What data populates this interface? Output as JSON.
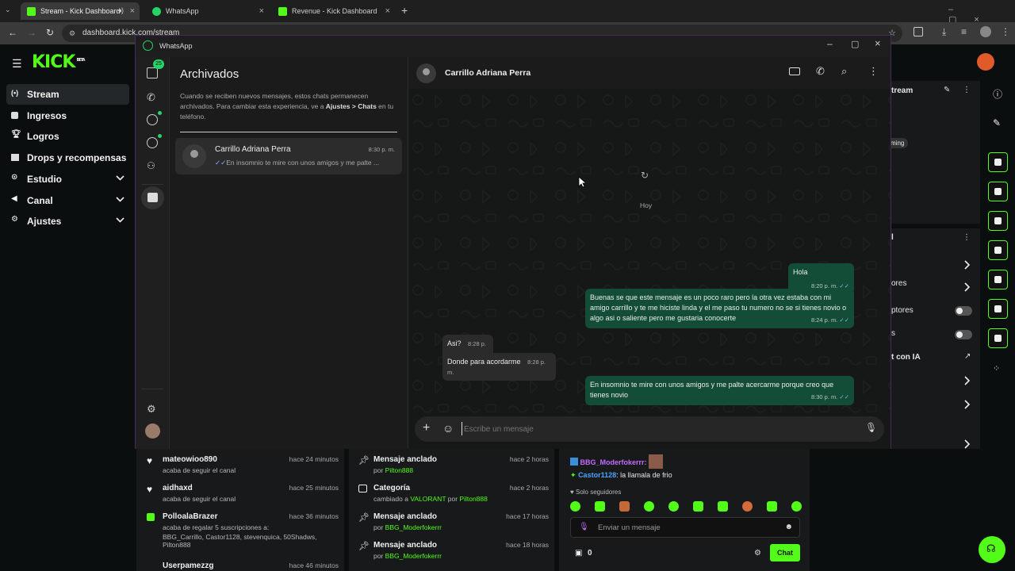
{
  "browser": {
    "tabs": [
      {
        "label": "Stream - Kick Dashboard",
        "active": true,
        "audio": true
      },
      {
        "label": "WhatsApp",
        "active": false
      },
      {
        "label": "Revenue - Kick Dashboard",
        "active": false
      }
    ],
    "url": "dashboard.kick.com/stream"
  },
  "kick": {
    "logo": "KICK",
    "logo_badge": "BETA",
    "sidebar": [
      {
        "label": "Stream",
        "icon": "broadcast-icon",
        "active": true
      },
      {
        "label": "Ingresos",
        "icon": "dollar-icon"
      },
      {
        "label": "Logros",
        "icon": "trophy-icon"
      },
      {
        "label": "Drops y recompensas",
        "icon": "gift-icon"
      },
      {
        "label": "Estudio",
        "icon": "studio-icon",
        "expandable": true
      },
      {
        "label": "Canal",
        "icon": "megaphone-icon",
        "expandable": true
      },
      {
        "label": "Ajustes",
        "icon": "gear-icon",
        "expandable": true
      }
    ],
    "right_panel": {
      "stream_title": "tream",
      "badge": "ming",
      "rows": [
        "ores",
        "ptores",
        "s",
        "t con IA"
      ]
    },
    "activity_feed": [
      {
        "title": "mateowioo890",
        "sub": "acaba de seguir el canal",
        "time": "hace 24 minutos",
        "icon": "heart-icon"
      },
      {
        "title": "aidhaxd",
        "sub": "acaba de seguir el canal",
        "time": "hace 25 minutos",
        "icon": "heart-icon"
      },
      {
        "title": "PolloalaBrazer",
        "sub": "acaba de regalar 5 suscripciones a:",
        "names": "BBG_Carrillo, Castor1128, stevenquica, 50Shadws, Pilton888",
        "time": "hace 36 minutos",
        "icon": "gift-icon"
      },
      {
        "title": "Userpamezzg",
        "time": "hace 46 minutos",
        "icon": "heart-icon"
      }
    ],
    "mod_log": [
      {
        "title": "Mensaje anclado",
        "by_prefix": "por",
        "by": "Pilton888",
        "time": "hace 2 horas",
        "icon": "pin-icon"
      },
      {
        "title": "Categoría",
        "by_prefix": "cambiado a",
        "by": "VALORANT",
        "by2_prefix": "por",
        "by2": "Pilton888",
        "time": "hace 2 horas",
        "icon": "category-icon"
      },
      {
        "title": "Mensaje anclado",
        "by_prefix": "por",
        "by": "BBG_Moderfokerrr",
        "time": "hace 17 horas",
        "icon": "pin-icon"
      },
      {
        "title": "Mensaje anclado",
        "by_prefix": "por",
        "by": "BBG_Moderfokerrr",
        "time": "hace 18 horas",
        "icon": "pin-icon"
      }
    ],
    "chat": {
      "msg1_user": "BBG_Moderfokerrr:",
      "msg2_user": "Castor1128",
      "msg2_text": ": la llamala de frio",
      "mode": "Solo seguidores",
      "input_placeholder": "Enviar un mensaje",
      "count": "0",
      "send_label": "Chat"
    }
  },
  "whatsapp": {
    "app_title": "WhatsApp",
    "unread_badge": "25",
    "list": {
      "title": "Archivados",
      "info_text": "Cuando se reciben nuevos mensajes, estos chats permanecen archivados. Para cambiar esta experiencia, ve a ",
      "info_bold": "Ajustes > Chats",
      "info_tail": " en tu teléfono.",
      "chats": [
        {
          "name": "Carrillo Adriana Perra",
          "time": "8:30 p. m.",
          "preview": "En insomnio te mire con unos amigos y me palte ..."
        }
      ]
    },
    "chat": {
      "contact": "Carrillo Adriana Perra",
      "day_divider": "Hoy",
      "messages": [
        {
          "dir": "out",
          "text": "Hola",
          "time": "8:20 p. m."
        },
        {
          "dir": "out",
          "text": "Buenas se que este mensaje es un poco raro pero la otra vez estaba con mi amigo carrillo y te me hiciste linda y el me paso tu numero no se si tienes novio o algo asi o saliente pero me gustaria conocerte",
          "time": "8:24 p. m."
        },
        {
          "dir": "in",
          "text": "Asi?",
          "time": "8:28 p. m."
        },
        {
          "dir": "in",
          "text": "Donde para acordarme",
          "time": "8:28 p. m."
        },
        {
          "dir": "out",
          "text": "En insomnio te mire con unos amigos y me palte acercarme porque creo que tienes novio",
          "time": "8:30 p. m."
        }
      ],
      "composer_placeholder": "Escribe un mensaje"
    }
  },
  "colors": {
    "kick_green": "#53fc18",
    "wa_out": "#144d37",
    "wa_in": "#2b2b2b"
  }
}
